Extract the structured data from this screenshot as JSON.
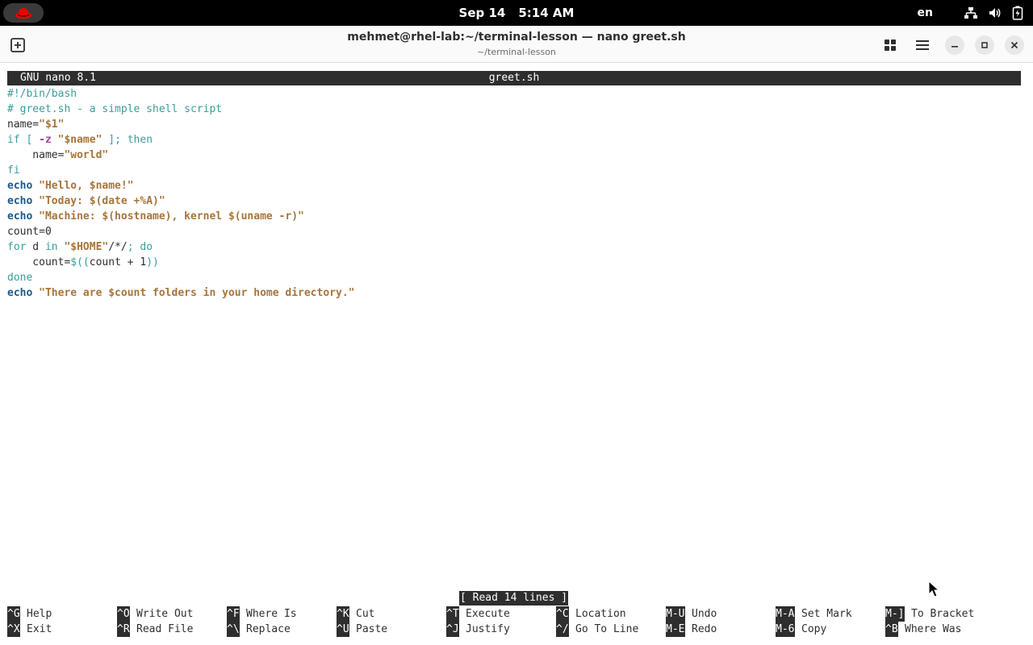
{
  "topbar": {
    "date": "Sep 14",
    "time": "5:14 AM",
    "language": "en",
    "icons": [
      "redhat-logo-icon",
      "network-icon",
      "volume-icon",
      "battery-icon"
    ]
  },
  "window": {
    "title": "mehmet@rhel-lab:~/terminal-lesson — nano greet.sh",
    "subtitle": "~/terminal-lesson"
  },
  "nano": {
    "version": "GNU nano 8.1",
    "filename": "greet.sh",
    "status": "[ Read 14 lines ]"
  },
  "code_lines": [
    "#!/bin/bash",
    "# greet.sh - a simple shell script",
    "name=\"$1\"",
    "if [ -z \"$name\" ]; then",
    "    name=\"world\"",
    "fi",
    "echo \"Hello, $name!\"",
    "echo \"Today: $(date +%A)\"",
    "echo \"Machine: $(hostname), kernel $(uname -r)\"",
    "count=0",
    "for d in \"$HOME\"/*/; do",
    "    count=$((count + 1))",
    "done",
    "echo \"There are $count folders in your home directory.\""
  ],
  "shortcuts": [
    {
      "key": "^G",
      "label": "Help"
    },
    {
      "key": "^X",
      "label": "Exit"
    },
    {
      "key": "^O",
      "label": "Write Out"
    },
    {
      "key": "^R",
      "label": "Read File"
    },
    {
      "key": "^F",
      "label": "Where Is"
    },
    {
      "key": "^\\",
      "label": "Replace"
    },
    {
      "key": "^K",
      "label": "Cut"
    },
    {
      "key": "^U",
      "label": "Paste"
    },
    {
      "key": "^T",
      "label": "Execute"
    },
    {
      "key": "^J",
      "label": "Justify"
    },
    {
      "key": "^C",
      "label": "Location"
    },
    {
      "key": "^/",
      "label": "Go To Line"
    },
    {
      "key": "M-U",
      "label": "Undo"
    },
    {
      "key": "M-E",
      "label": "Redo"
    },
    {
      "key": "M-A",
      "label": "Set Mark"
    },
    {
      "key": "M-6",
      "label": "Copy"
    },
    {
      "key": "M-]",
      "label": "To Bracket"
    },
    {
      "key": "^B",
      "label": "Where Was"
    }
  ],
  "colors": {
    "comment": "#3b9c9c",
    "keyword": "#3b9c9c",
    "builtin": "#1a5a8c",
    "string": "#a8743a",
    "option": "#a13ea1"
  }
}
